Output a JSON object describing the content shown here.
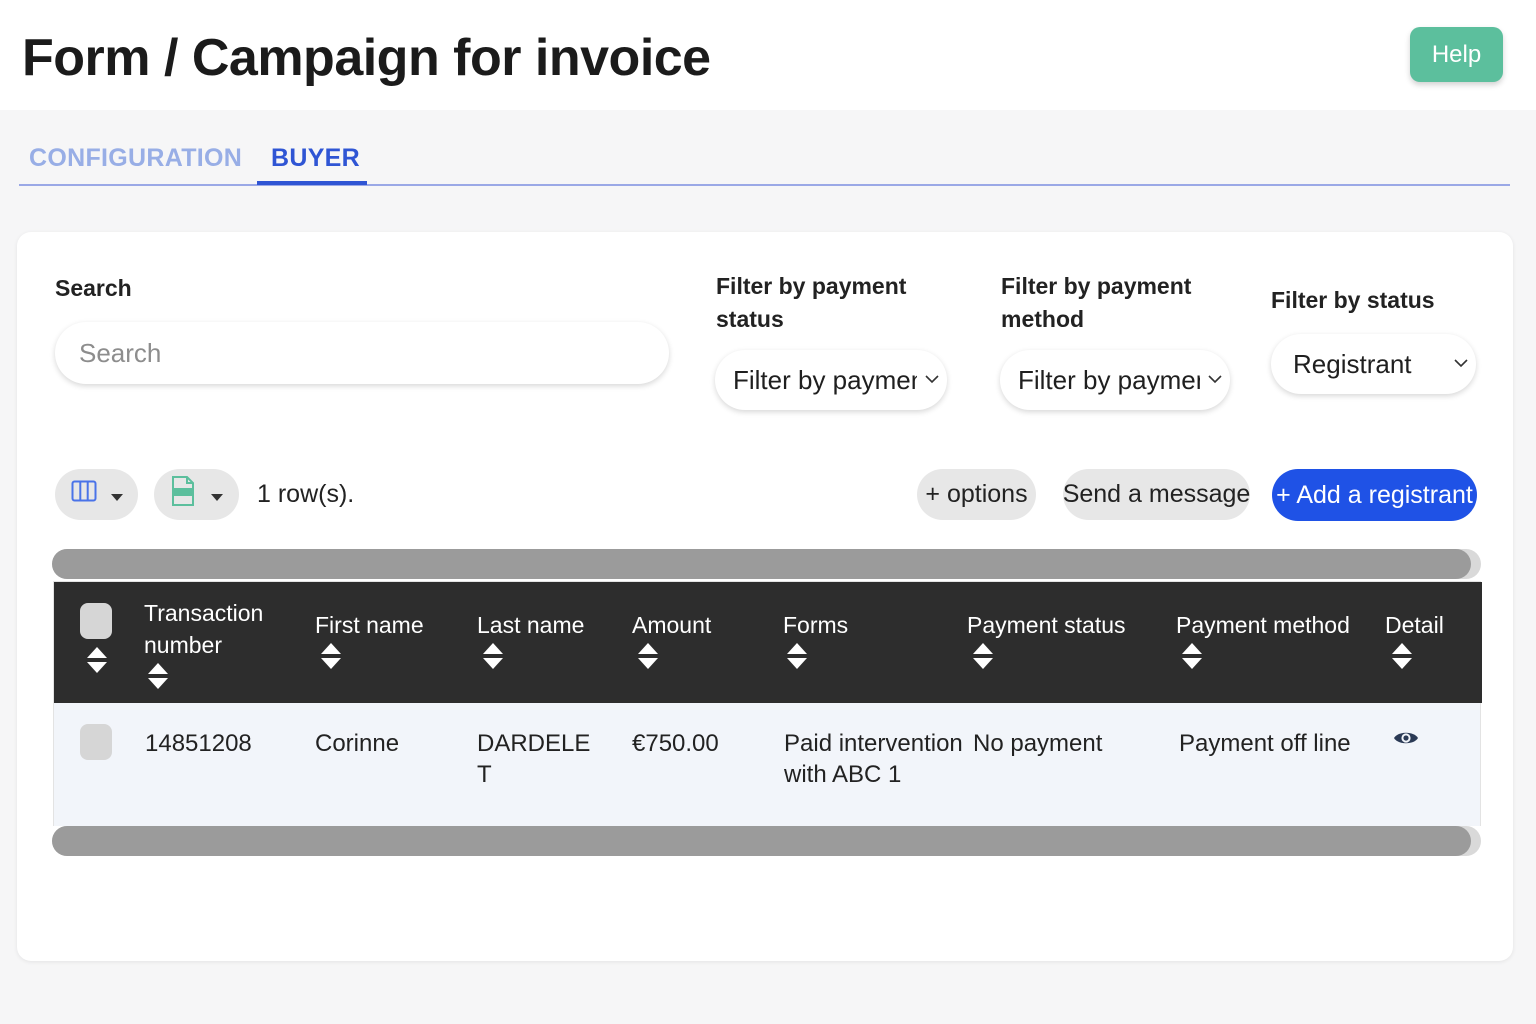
{
  "header": {
    "title": "Form / Campaign for invoice",
    "help_label": "Help"
  },
  "tabs": [
    {
      "label": "CONFIGURATION",
      "active": false
    },
    {
      "label": "BUYER",
      "active": true
    }
  ],
  "filters": {
    "search_label": "Search",
    "search_placeholder": "Search",
    "payment_status_label_1": "Filter by payment",
    "payment_status_label_2": "status",
    "payment_status_value": "Filter by payment s",
    "payment_method_label_1": "Filter by payment",
    "payment_method_label_2": "method",
    "payment_method_value": "Filter by payment m",
    "status_label": "Filter by status",
    "status_value": "Registrant"
  },
  "toolbar": {
    "rows_count": "1 row(s).",
    "options_label": "+ options",
    "send_message_label": "Send a message",
    "add_registrant_label": "+ Add a registrant",
    "icons": [
      "columns-icon",
      "xlsx-export-icon",
      "caret-down-icon"
    ]
  },
  "table": {
    "headers": {
      "transaction_1": "Transaction",
      "transaction_2": "number",
      "first_name": "First name",
      "last_name": "Last name",
      "amount": "Amount",
      "forms": "Forms",
      "payment_status": "Payment status",
      "payment_method": "Payment method",
      "detail": "Detail"
    },
    "rows": [
      {
        "transaction_number": "14851208",
        "first_name": "Corinne",
        "last_name_1": "DARDELE",
        "last_name_2": "T",
        "amount": "€750.00",
        "forms_1": "Paid intervention",
        "forms_2": "with ABC 1",
        "payment_status": "No payment",
        "payment_method": "Payment off line"
      }
    ]
  },
  "colors": {
    "help": "#5cbf9d",
    "tab_active": "#2f55d4",
    "tab_inactive": "#98aee6",
    "primary_button": "#1f52e6",
    "table_header": "#2d2d2d"
  }
}
